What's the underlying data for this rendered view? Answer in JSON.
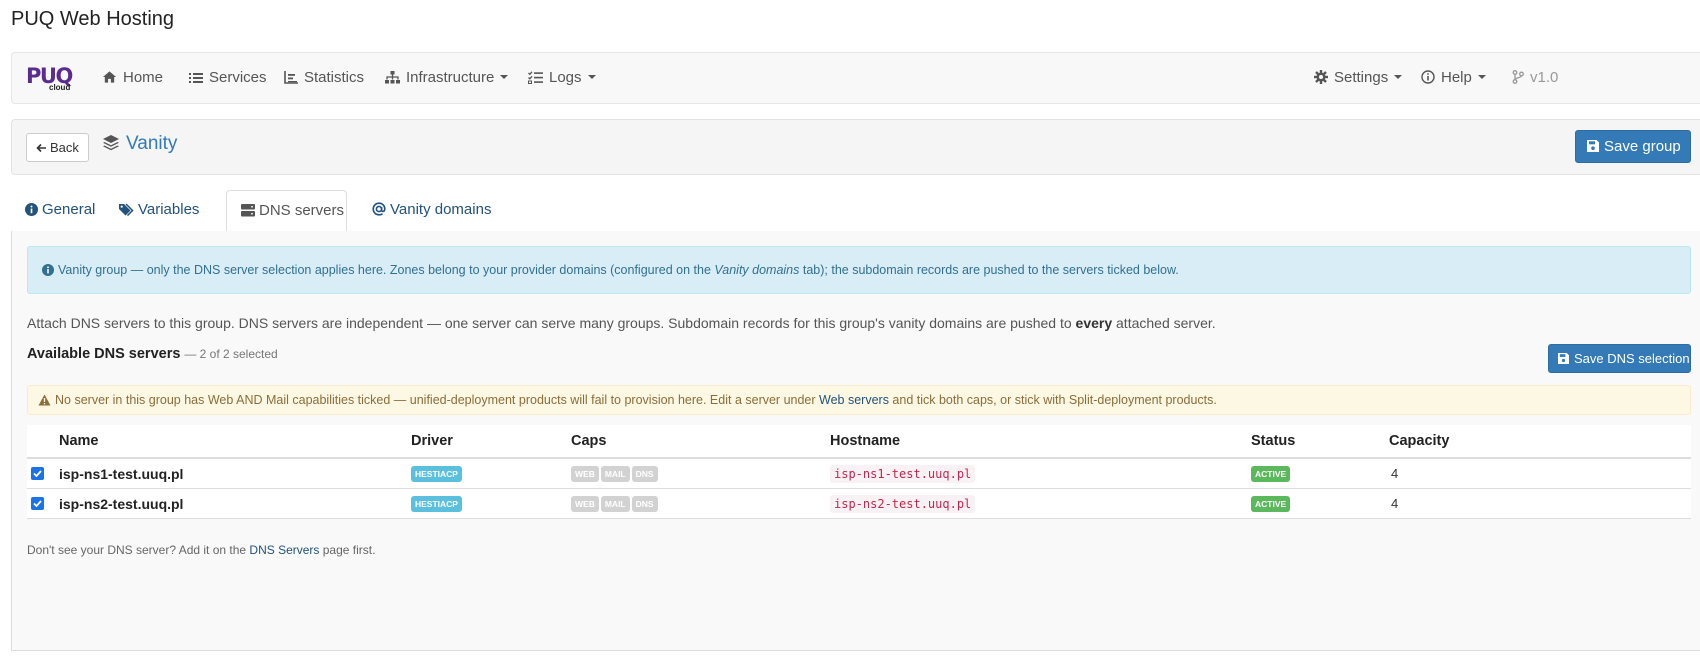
{
  "app": {
    "title": "PUQ Web Hosting",
    "brand_main": "PUQ",
    "brand_sub": "cloud"
  },
  "nav": {
    "home": "Home",
    "services": "Services",
    "statistics": "Statistics",
    "infrastructure": "Infrastructure",
    "logs": "Logs",
    "settings": "Settings",
    "help": "Help",
    "version": "v1.0"
  },
  "header": {
    "back_label": "Back",
    "title": "Vanity",
    "save_label": "Save group"
  },
  "tabs": [
    {
      "label": "General",
      "icon": "info-circle-icon"
    },
    {
      "label": "Variables",
      "icon": "tags-icon"
    },
    {
      "label": "DNS servers",
      "icon": "server-icon"
    },
    {
      "label": "Vanity domains",
      "icon": "at-icon"
    }
  ],
  "info_alert": {
    "before": "Vanity group — only the DNS server selection applies here. Zones belong to your provider domains (configured on the ",
    "em": "Vanity domains",
    "after": " tab); the subdomain records are pushed to the servers ticked below."
  },
  "description": {
    "before": "Attach DNS servers to this group. DNS servers are independent — one server can serve many groups. Subdomain records for this group's vanity domains are pushed to ",
    "bold": "every",
    "after": " attached server."
  },
  "servers_section": {
    "heading": "Available DNS servers",
    "count": "— 2 of 2 selected",
    "save_label": "Save DNS selection"
  },
  "warning": {
    "before": "No server in this group has Web AND Mail capabilities ticked — unified-deployment products will fail to provision here. Edit a server under ",
    "link": "Web servers",
    "after": " and tick both caps, or stick with Split-deployment products."
  },
  "table": {
    "columns": [
      "Name",
      "Driver",
      "Caps",
      "Hostname",
      "Status",
      "Capacity"
    ],
    "rows": [
      {
        "checked": true,
        "name": "isp-ns1-test.uuq.pl",
        "driver": "HESTIACP",
        "caps": [
          "WEB",
          "MAIL",
          "DNS"
        ],
        "hostname": "isp-ns1-test.uuq.pl",
        "status": "ACTIVE",
        "capacity": "4"
      },
      {
        "checked": true,
        "name": "isp-ns2-test.uuq.pl",
        "driver": "HESTIACP",
        "caps": [
          "WEB",
          "MAIL",
          "DNS"
        ],
        "hostname": "isp-ns2-test.uuq.pl",
        "status": "ACTIVE",
        "capacity": "4"
      }
    ]
  },
  "footnote": {
    "before": "Don't see your DNS server? Add it on the ",
    "link": "DNS Servers",
    "after": " page first."
  },
  "colors": {
    "primary": "#337ab7",
    "info_bg": "#d9edf7",
    "warning_bg": "#fcf8e3",
    "success": "#5cb85c",
    "label_info": "#5bc0de",
    "brand": "#5b2c8f"
  }
}
